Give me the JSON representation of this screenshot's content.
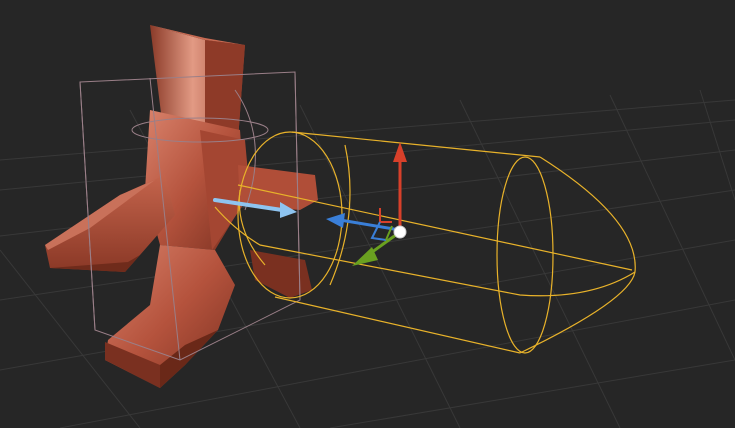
{
  "viewport": {
    "background": "#262626",
    "grid_color": "#3a3a3a",
    "mesh_color": "#b5533d",
    "mesh_highlight": "#e0907a",
    "mesh_shadow": "#7a3020",
    "bbox_color": "#9a7f88",
    "collider_color": "#e8b22a",
    "gizmo": {
      "y_axis_color": "#d8402a",
      "x_axis_color": "#3a7fd8",
      "z_axis_color": "#6aa020",
      "light_axis_color": "#8ec4f0",
      "pivot_color": "#ffffff"
    },
    "icons": {
      "move_gizmo": "transform-move-gizmo",
      "pivot": "pivot-sphere"
    }
  }
}
